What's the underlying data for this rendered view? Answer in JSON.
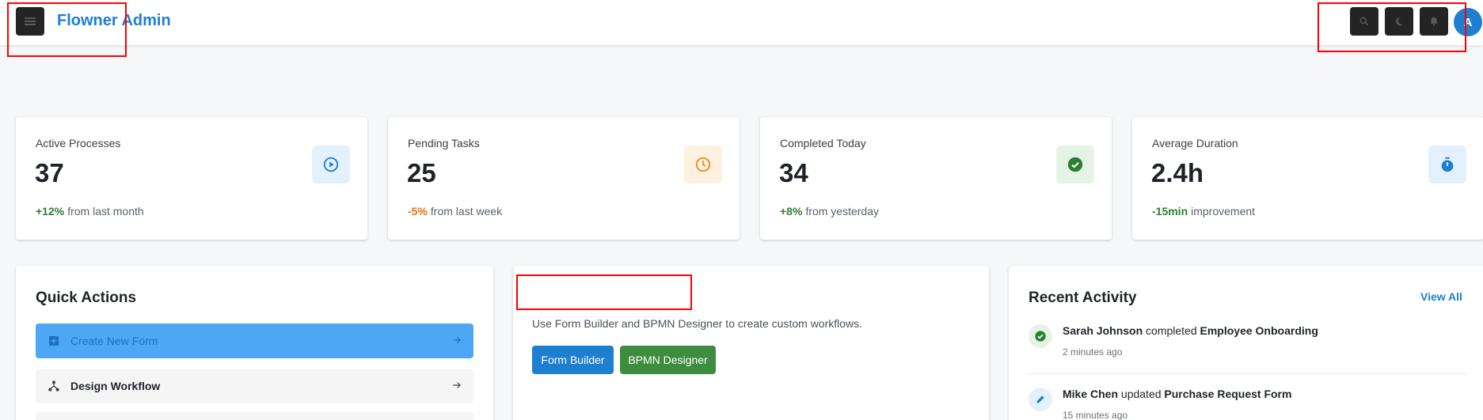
{
  "header": {
    "app_title": "Flowner Admin",
    "avatar_initial": "A",
    "icons": [
      "menu-icon",
      "search-icon",
      "moon-icon",
      "bell-icon"
    ]
  },
  "stats": [
    {
      "label": "Active Processes",
      "value": "37",
      "delta": "+12%",
      "delta_color": "#2e7d32",
      "suffix": "from last month",
      "icon": "play-circle-icon",
      "icon_bg": "#e3f1fc",
      "icon_color": "#1e7ed0"
    },
    {
      "label": "Pending Tasks",
      "value": "25",
      "delta": "-5%",
      "delta_color": "#ef6c00",
      "suffix": "from last week",
      "icon": "clock-icon",
      "icon_bg": "#fff1e0",
      "icon_color": "#f08a1c"
    },
    {
      "label": "Completed Today",
      "value": "34",
      "delta": "+8%",
      "delta_color": "#2e7d32",
      "suffix": "from yesterday",
      "icon": "check-circle-icon",
      "icon_bg": "#e5f3e6",
      "icon_color": "#2e7d32"
    },
    {
      "label": "Average Duration",
      "value": "2.4h",
      "delta": "-15min",
      "delta_color": "#2e7d32",
      "suffix": "improvement",
      "icon": "timer-icon",
      "icon_bg": "#e3f1fc",
      "icon_color": "#1e7ed0"
    }
  ],
  "quick_actions": {
    "title": "Quick Actions",
    "items": [
      {
        "label": "Create New Form",
        "icon": "add-box-icon"
      },
      {
        "label": "Design Workflow",
        "icon": "workflow-icon"
      }
    ]
  },
  "middle_panel": {
    "description": "Use Form Builder and BPMN Designer to create custom workflows.",
    "buttons": [
      {
        "label": "Form Builder",
        "color": "#1e7ed0"
      },
      {
        "label": "BPMN Designer",
        "color": "#3d8d3e"
      }
    ]
  },
  "recent_activity": {
    "title": "Recent Activity",
    "view_all": "View All",
    "items": [
      {
        "user": "Sarah Johnson",
        "action": "completed",
        "target": "Employee Onboarding",
        "time": "2 minutes ago",
        "icon": "check-circle-icon"
      },
      {
        "user": "Mike Chen",
        "action": "updated",
        "target": "Purchase Request Form",
        "time": "15 minutes ago",
        "icon": "edit-icon"
      }
    ]
  },
  "colors": {
    "brand": "#1e7ed0",
    "success": "#2e7d32",
    "warning": "#ef6c00",
    "annotation": "#ff0000"
  }
}
